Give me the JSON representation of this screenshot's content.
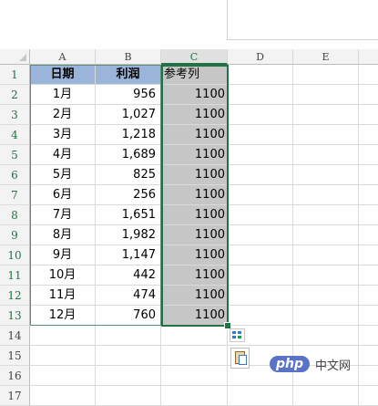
{
  "columns": [
    "A",
    "B",
    "C",
    "D",
    "E"
  ],
  "rows": [
    {
      "n": "1",
      "a": "日期",
      "b": "利润",
      "c": "参考列"
    },
    {
      "n": "2",
      "a": "1月",
      "b": "956",
      "c": "1100"
    },
    {
      "n": "3",
      "a": "2月",
      "b": "1,027",
      "c": "1100"
    },
    {
      "n": "4",
      "a": "3月",
      "b": "1,218",
      "c": "1100"
    },
    {
      "n": "5",
      "a": "4月",
      "b": "1,689",
      "c": "1100"
    },
    {
      "n": "6",
      "a": "5月",
      "b": "825",
      "c": "1100"
    },
    {
      "n": "7",
      "a": "6月",
      "b": "256",
      "c": "1100"
    },
    {
      "n": "8",
      "a": "7月",
      "b": "1,651",
      "c": "1100"
    },
    {
      "n": "9",
      "a": "8月",
      "b": "1,982",
      "c": "1100"
    },
    {
      "n": "10",
      "a": "9月",
      "b": "1,147",
      "c": "1100"
    },
    {
      "n": "11",
      "a": "10月",
      "b": "442",
      "c": "1100"
    },
    {
      "n": "12",
      "a": "11月",
      "b": "474",
      "c": "1100"
    },
    {
      "n": "13",
      "a": "12月",
      "b": "760",
      "c": "1100"
    },
    {
      "n": "14",
      "a": "",
      "b": "",
      "c": ""
    },
    {
      "n": "15",
      "a": "",
      "b": "",
      "c": ""
    },
    {
      "n": "16",
      "a": "",
      "b": "",
      "c": ""
    },
    {
      "n": "17",
      "a": "",
      "b": "",
      "c": ""
    }
  ],
  "colors": {
    "header_fill": "#9bb4d9",
    "selection_fill": "#c6c6c6",
    "selection_border": "#217346"
  },
  "icons": {
    "quick_analysis": "quick-analysis-icon",
    "paste_options": "paste-options-icon"
  },
  "watermark": {
    "logo": "php",
    "text": "中文网"
  }
}
